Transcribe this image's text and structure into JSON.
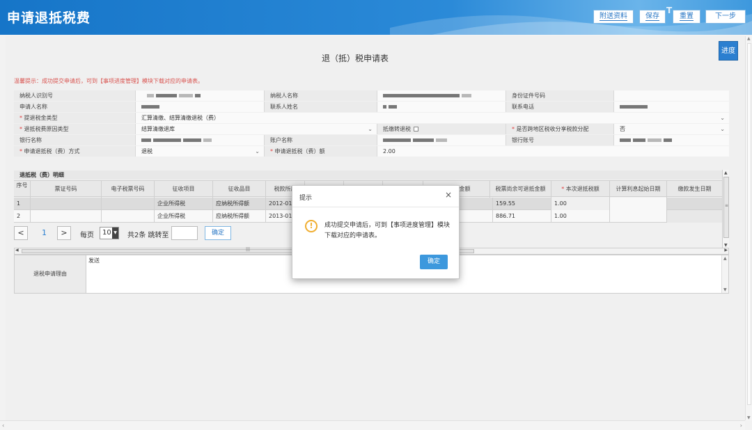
{
  "header": {
    "title": "申请退抵税费",
    "buttons": {
      "attach": "附送资料",
      "save": "保存",
      "reset": "重置",
      "next": "下一步"
    },
    "mark": "T"
  },
  "form": {
    "title": "退（抵）税申请表",
    "progress_label": "进度",
    "tip": "温馨提示：成功提交申请后，可到【事项进度管理】模块下载对应的申请表。",
    "labels": {
      "taxpayer_id": "纳税人识别号",
      "taxpayer_name": "纳税人名称",
      "id_number": "身份证件号码",
      "applicant_name": "申请人名称",
      "contact_name": "联系人姓名",
      "contact_phone": "联系电话",
      "refund_type": "提退税金类型",
      "refund_reason_type": "退抵税费原因类型",
      "offset_transfer": "抵缴转退税",
      "cross_region": "是否跨地区税收分享税款分配",
      "bank_name": "银行名称",
      "account_name": "账户名称",
      "bank_account": "银行账号",
      "refund_method": "申请退抵税（费）方式",
      "refund_amount": "申请退抵税（费）额"
    },
    "values": {
      "refund_type": "汇算清缴、结算清缴退税（费）",
      "refund_reason_type": "结算清缴退库",
      "cross_region": "否",
      "refund_method": "退税",
      "refund_amount": "2.00"
    }
  },
  "detail": {
    "title": "退抵税（费）明细",
    "columns": [
      "序号",
      "票证号码",
      "电子税票号码",
      "征收项目",
      "征收品目",
      "税款所属",
      "",
      "",
      "",
      "已退抵金额",
      "税票尚余可退抵金额",
      "本次退抵税额",
      "计算利息起始日期",
      "缴款发生日期"
    ],
    "rows": [
      {
        "seq": "1",
        "item": "企业所得税",
        "sub": "应纳税所得额",
        "date": "2012-01-01",
        "remain": "159.55",
        "current": "1.00"
      },
      {
        "seq": "2",
        "item": "企业所得税",
        "sub": "应纳税所得额",
        "date": "2013-01-01",
        "remain": "886.71",
        "current": "1.00"
      }
    ]
  },
  "pager": {
    "prev": "<",
    "page": "1",
    "next": ">",
    "per_page_label": "每页",
    "per_page": "10",
    "total": "共2条 跳转至",
    "go": "确定"
  },
  "reason": {
    "label": "退税申请理由",
    "text": "发送"
  },
  "dialog": {
    "title": "提示",
    "close": "×",
    "icon": "!",
    "message": "成功提交申请后，可到【事项进度管理】模块下载对应的申请表。",
    "ok": "确定"
  },
  "colors": {
    "header_blue": "#1675c8",
    "accent_blue": "#3d98dd",
    "tip_red": "#d9534f",
    "warn_orange": "#f0ad2e"
  }
}
